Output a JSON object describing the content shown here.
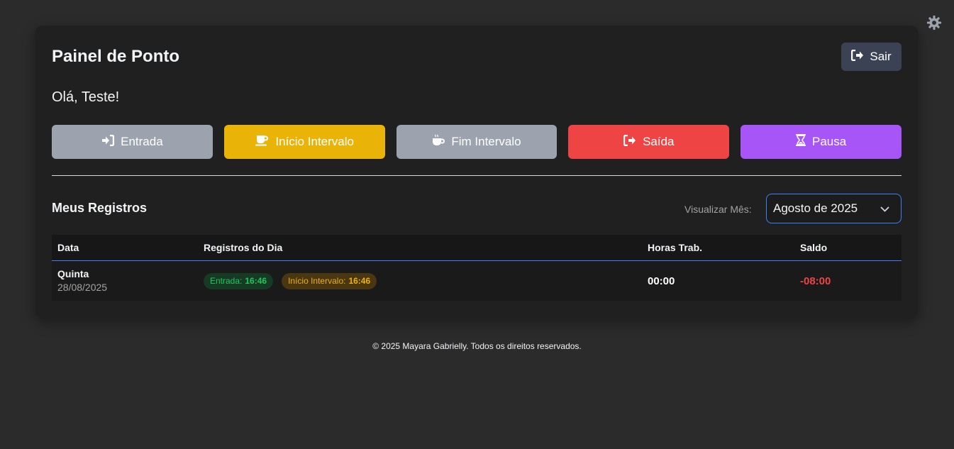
{
  "header": {
    "title": "Painel de Ponto",
    "logout_label": "Sair",
    "greeting": "Olá, Teste!"
  },
  "actions": [
    {
      "label": "Entrada",
      "icon": "sign-in-icon",
      "color": "#9ca3af"
    },
    {
      "label": "Início Intervalo",
      "icon": "coffee-icon",
      "color": "#eab308"
    },
    {
      "label": "Fim Intervalo",
      "icon": "hot-coffee-icon",
      "color": "#9ca3af"
    },
    {
      "label": "Saída",
      "icon": "sign-out-icon",
      "color": "#ef4444"
    },
    {
      "label": "Pausa",
      "icon": "hourglass-icon",
      "color": "#a855f7"
    }
  ],
  "records": {
    "title": "Meus Registros",
    "month_label": "Visualizar Mês:",
    "month_selected": "Agosto de 2025",
    "columns": [
      "Data",
      "Registros do Dia",
      "Horas Trab.",
      "Saldo"
    ],
    "rows": [
      {
        "day": "Quinta",
        "date": "28/08/2025",
        "entries": [
          {
            "label": "Entrada:",
            "time": "16:46"
          },
          {
            "label": "Início Intervalo:",
            "time": "16:46"
          }
        ],
        "hours": "00:00",
        "balance": "-08:00"
      }
    ]
  },
  "footer": "© 2025 Mayara Gabrielly. Todos os direitos reservados."
}
